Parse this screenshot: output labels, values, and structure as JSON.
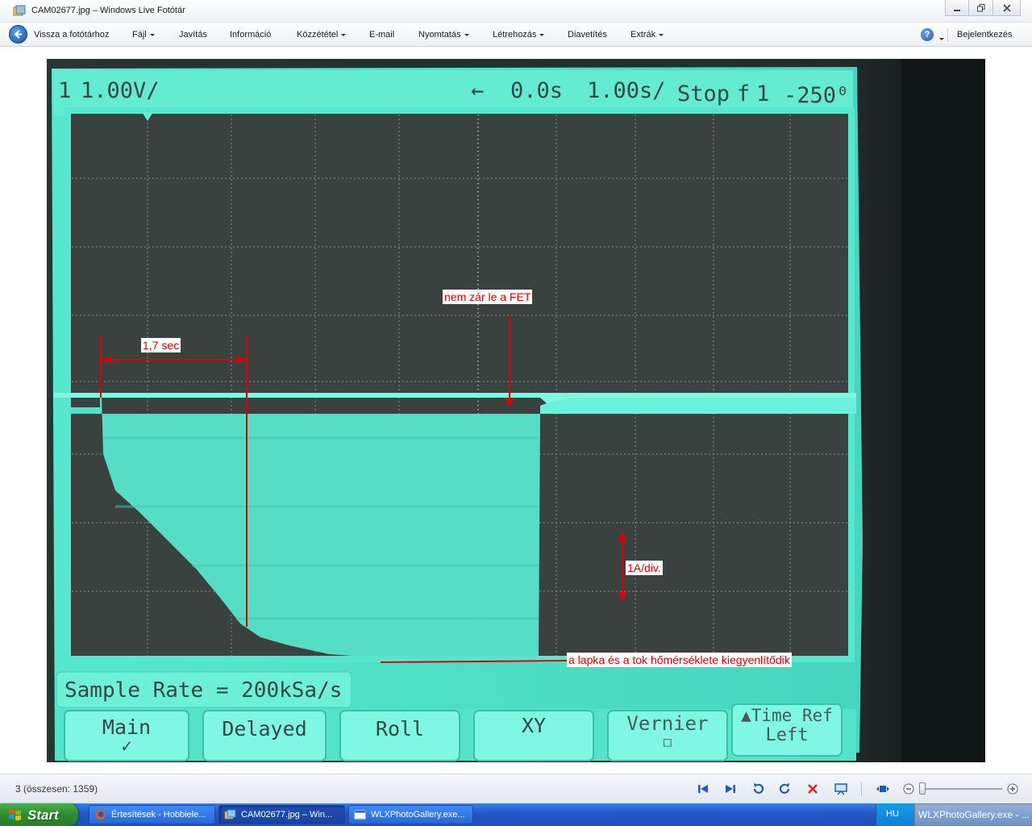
{
  "window": {
    "title": "CAM02677.jpg – Windows Live Fotótár"
  },
  "toolbar": {
    "back_label": "Vissza a fotótárhoz",
    "items": [
      {
        "label": "Fájl",
        "has_menu": true
      },
      {
        "label": "Javítás",
        "has_menu": false
      },
      {
        "label": "Információ",
        "has_menu": false
      },
      {
        "label": "Közzététel",
        "has_menu": true
      },
      {
        "label": "E-mail",
        "has_menu": false
      },
      {
        "label": "Nyomtatás",
        "has_menu": true
      },
      {
        "label": "Létrehozás",
        "has_menu": true
      },
      {
        "label": "Diavetítés",
        "has_menu": false
      },
      {
        "label": "Extrák",
        "has_menu": true
      }
    ],
    "help_label": "?",
    "signin_label": "Bejelentkezés"
  },
  "scope": {
    "status_line": {
      "channel": "1",
      "volts_per_div": "1.00V/",
      "arrow": "←",
      "delay": "0.0s",
      "time_per_div": "1.00s/",
      "mode": "Stop",
      "trigger_slope": "f",
      "trigger_source": "1",
      "trigger_level": "-250⁰"
    },
    "sample_rate": "Sample Rate = 200kSa/s",
    "softkeys": [
      {
        "label": "Main",
        "sub": "✓"
      },
      {
        "label": "Delayed",
        "sub": ""
      },
      {
        "label": "Roll",
        "sub": ""
      },
      {
        "label": "XY",
        "sub": ""
      },
      {
        "label": "Vernier",
        "sub": "□"
      },
      {
        "label": "▲Time Ref",
        "sub": "Left"
      }
    ],
    "annotations": {
      "duration": "1,7 sec",
      "fet": "nem zár le a FET",
      "scale": "1A/div.",
      "temperature": "a lapka és a tok hőmérséklete kiegyenlítődik"
    },
    "colors": {
      "trace": "#5df2d6",
      "annotation": "#e00000",
      "screen": "#333b39"
    }
  },
  "status": {
    "counter": "3 (összesen: 1359)"
  },
  "controls": {
    "icons": [
      "first-icon",
      "next-icon",
      "rotate-left-icon",
      "rotate-right-icon",
      "delete-icon",
      "slideshow-icon",
      "fit-icon",
      "zoom-out-icon",
      "zoom-in-icon"
    ]
  },
  "taskbar": {
    "start_label": "Start",
    "tasks": [
      {
        "label": "Értesítések - Hobbiele...",
        "active": false
      },
      {
        "label": "CAM02677.jpg – Win...",
        "active": true
      },
      {
        "label": "WLXPhotoGallery.exe...",
        "active": false
      }
    ],
    "language": "HU",
    "tooltip": "WLXPhotoGallery.exe - ..."
  }
}
